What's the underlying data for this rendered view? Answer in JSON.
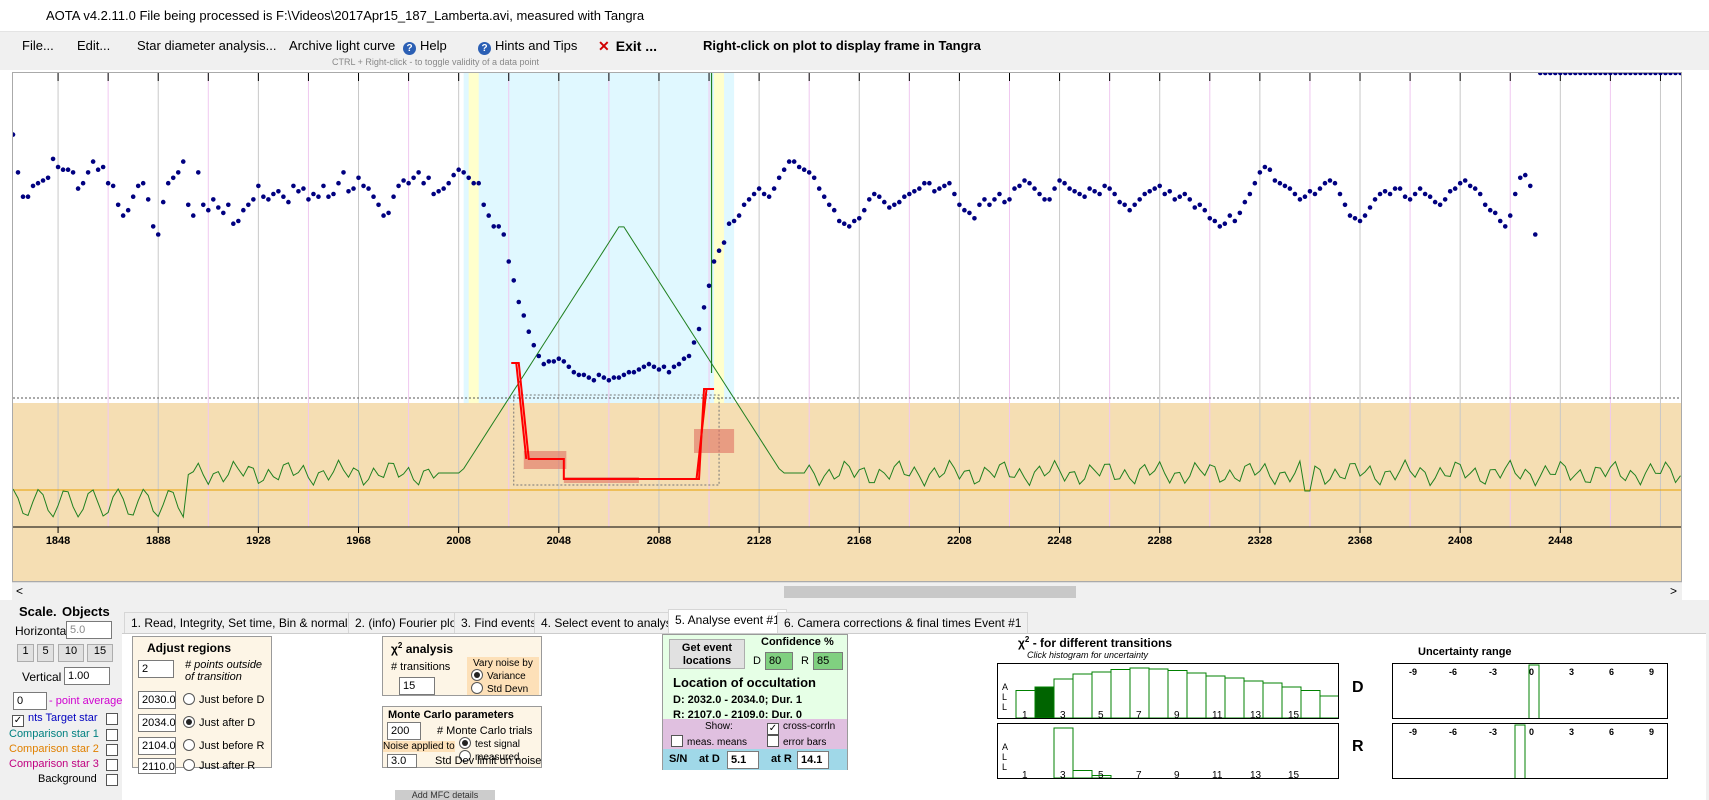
{
  "window": {
    "title": "AOTA v4.2.11.0    File being processed is F:\\Videos\\2017Apr15_187_Lamberta.avi, measured with Tangra"
  },
  "menu": {
    "file": "File...",
    "edit": "Edit...",
    "star_diameter": "Star diameter analysis...",
    "archive": "Archive light curve",
    "help": "Help",
    "hints": "Hints and Tips",
    "exit": "Exit ...",
    "rightclick_hint": "Right-click on plot to display frame in Tangra",
    "ctrl_hint": "CTRL + Right-click  -  to toggle validity of a data point"
  },
  "x_ticks": [
    "1848",
    "1888",
    "1928",
    "1968",
    "2008",
    "2048",
    "2088",
    "2128",
    "2168",
    "2208",
    "2248",
    "2288",
    "2328",
    "2368",
    "2408",
    "2448"
  ],
  "colors": {
    "points": "#000080",
    "model": "#ff0000",
    "fourier": "#208020",
    "lower_band": "#f5deb3",
    "event_shade": "#e0f8ff",
    "edge_shade": "#ffffcc",
    "baseline": "#e8a000"
  },
  "chart_data": {
    "type": "scatter",
    "x_range": [
      1830,
      2497
    ],
    "x": [
      1830,
      1832,
      1834,
      1836,
      1838,
      1840,
      1842,
      1844,
      1846,
      1848,
      1850,
      1852,
      1854,
      1856,
      1858,
      1860,
      1862,
      1864,
      1866,
      1868,
      1870,
      1872,
      1874,
      1876,
      1878,
      1880,
      1882,
      1884,
      1886,
      1888,
      1890,
      1892,
      1894,
      1896,
      1898,
      1900,
      1902,
      1904,
      1906,
      1908,
      1910,
      1912,
      1914,
      1916,
      1918,
      1920,
      1922,
      1924,
      1926,
      1928,
      1930,
      1932,
      1934,
      1936,
      1938,
      1940,
      1942,
      1944,
      1946,
      1948,
      1950,
      1952,
      1954,
      1956,
      1958,
      1960,
      1962,
      1964,
      1966,
      1968,
      1970,
      1972,
      1974,
      1976,
      1978,
      1980,
      1982,
      1984,
      1986,
      1988,
      1990,
      1992,
      1994,
      1996,
      1998,
      2000,
      2002,
      2004,
      2006,
      2008,
      2010,
      2012,
      2014,
      2016,
      2018,
      2020,
      2022,
      2024,
      2026,
      2028,
      2030,
      2032,
      2034,
      2036,
      2038,
      2040,
      2042,
      2044,
      2046,
      2048,
      2050,
      2052,
      2054,
      2056,
      2058,
      2060,
      2062,
      2064,
      2066,
      2068,
      2070,
      2072,
      2074,
      2076,
      2078,
      2080,
      2082,
      2084,
      2086,
      2088,
      2090,
      2092,
      2094,
      2096,
      2098,
      2100,
      2102,
      2104,
      2106,
      2108,
      2110,
      2112,
      2114,
      2116,
      2118,
      2120,
      2122,
      2124,
      2126,
      2128,
      2130,
      2132,
      2134,
      2136,
      2138,
      2140,
      2142,
      2144,
      2146,
      2148,
      2150,
      2152,
      2154,
      2156,
      2158,
      2160,
      2162,
      2164,
      2166,
      2168,
      2170,
      2172,
      2174,
      2176,
      2178,
      2180,
      2182,
      2184,
      2186,
      2188,
      2190,
      2192,
      2194,
      2196,
      2198,
      2200,
      2202,
      2204,
      2206,
      2208,
      2210,
      2212,
      2214,
      2216,
      2218,
      2220,
      2222,
      2224,
      2226,
      2228,
      2230,
      2232,
      2234,
      2236,
      2238,
      2240,
      2242,
      2244,
      2246,
      2248,
      2250,
      2252,
      2254,
      2256,
      2258,
      2260,
      2262,
      2264,
      2266,
      2268,
      2270,
      2272,
      2274,
      2276,
      2278,
      2280,
      2282,
      2284,
      2286,
      2288,
      2290,
      2292,
      2294,
      2296,
      2298,
      2300,
      2302,
      2304,
      2306,
      2308,
      2310,
      2312,
      2314,
      2316,
      2318,
      2320,
      2322,
      2324,
      2326,
      2328,
      2330,
      2332,
      2334,
      2336,
      2338,
      2340,
      2342,
      2344,
      2346,
      2348,
      2350,
      2352,
      2354,
      2356,
      2358,
      2360,
      2362,
      2364,
      2366,
      2368,
      2370,
      2372,
      2374,
      2376,
      2378,
      2380,
      2382,
      2384,
      2386,
      2388,
      2390,
      2392,
      2394,
      2396,
      2398,
      2400,
      2402,
      2404,
      2406,
      2408,
      2410,
      2412,
      2414,
      2416,
      2418,
      2420,
      2422,
      2424,
      2426,
      2428,
      2430,
      2432,
      2434,
      2436,
      2438,
      2440,
      2442,
      2444,
      2446,
      2448,
      2450,
      2452,
      2454,
      2456,
      2458,
      2460,
      2462,
      2464,
      2466,
      2468,
      2470,
      2472,
      2474,
      2476,
      2478,
      2480,
      2482,
      2484,
      2486,
      2488,
      2490,
      2492,
      2494,
      2496
    ],
    "y": [
      0.92,
      0.78,
      0.69,
      0.69,
      0.73,
      0.74,
      0.75,
      0.76,
      0.83,
      0.8,
      0.79,
      0.79,
      0.78,
      0.72,
      0.74,
      0.78,
      0.82,
      0.79,
      0.8,
      0.74,
      0.73,
      0.66,
      0.62,
      0.64,
      0.69,
      0.73,
      0.74,
      0.68,
      0.58,
      0.55,
      0.67,
      0.74,
      0.76,
      0.78,
      0.82,
      0.66,
      0.62,
      0.78,
      0.66,
      0.64,
      0.68,
      0.65,
      0.63,
      0.66,
      0.59,
      0.6,
      0.64,
      0.66,
      0.68,
      0.73,
      0.69,
      0.68,
      0.7,
      0.71,
      0.69,
      0.67,
      0.73,
      0.71,
      0.72,
      0.68,
      0.7,
      0.69,
      0.73,
      0.69,
      0.7,
      0.74,
      0.78,
      0.71,
      0.72,
      0.76,
      0.73,
      0.72,
      0.69,
      0.66,
      0.62,
      0.63,
      0.69,
      0.73,
      0.75,
      0.74,
      0.76,
      0.78,
      0.74,
      0.76,
      0.7,
      0.71,
      0.72,
      0.74,
      0.77,
      0.79,
      0.78,
      0.76,
      0.74,
      0.74,
      0.66,
      0.62,
      0.58,
      0.58,
      0.55,
      0.45,
      0.38,
      0.3,
      0.25,
      0.19,
      0.14,
      0.1,
      0.07,
      0.08,
      0.08,
      0.09,
      0.08,
      0.06,
      0.04,
      0.03,
      0.03,
      0.02,
      0.01,
      0.03,
      0.02,
      0.01,
      0.02,
      0.02,
      0.03,
      0.04,
      0.04,
      0.05,
      0.06,
      0.07,
      0.06,
      0.05,
      0.06,
      0.04,
      0.06,
      0.07,
      0.09,
      0.1,
      0.15,
      0.2,
      0.28,
      0.36,
      0.45,
      0.49,
      0.52,
      0.59,
      0.6,
      0.62,
      0.66,
      0.68,
      0.7,
      0.72,
      0.7,
      0.69,
      0.72,
      0.76,
      0.79,
      0.82,
      0.82,
      0.8,
      0.79,
      0.78,
      0.76,
      0.72,
      0.69,
      0.66,
      0.64,
      0.6,
      0.59,
      0.58,
      0.6,
      0.61,
      0.64,
      0.68,
      0.7,
      0.69,
      0.67,
      0.65,
      0.66,
      0.67,
      0.69,
      0.7,
      0.71,
      0.72,
      0.74,
      0.74,
      0.71,
      0.72,
      0.73,
      0.74,
      0.7,
      0.66,
      0.64,
      0.63,
      0.61,
      0.66,
      0.68,
      0.66,
      0.68,
      0.7,
      0.67,
      0.68,
      0.72,
      0.73,
      0.75,
      0.74,
      0.72,
      0.7,
      0.68,
      0.68,
      0.72,
      0.75,
      0.74,
      0.72,
      0.71,
      0.7,
      0.69,
      0.72,
      0.71,
      0.7,
      0.73,
      0.72,
      0.7,
      0.67,
      0.66,
      0.64,
      0.66,
      0.68,
      0.7,
      0.71,
      0.72,
      0.73,
      0.7,
      0.71,
      0.68,
      0.69,
      0.7,
      0.68,
      0.65,
      0.66,
      0.64,
      0.61,
      0.6,
      0.58,
      0.59,
      0.62,
      0.6,
      0.63,
      0.67,
      0.7,
      0.74,
      0.78,
      0.8,
      0.79,
      0.75,
      0.74,
      0.73,
      0.72,
      0.7,
      0.68,
      0.69,
      0.71,
      0.7,
      0.72,
      0.74,
      0.75,
      0.74,
      0.7,
      0.66,
      0.62,
      0.61,
      0.6,
      0.62,
      0.65,
      0.68,
      0.7,
      0.71,
      0.7,
      0.72,
      0.72,
      0.69,
      0.68,
      0.7,
      0.72,
      0.7,
      0.69,
      0.67,
      0.66,
      0.68,
      0.71,
      0.72,
      0.74,
      0.75,
      0.73,
      0.72,
      0.7,
      0.66,
      0.64,
      0.63,
      0.6,
      0.58,
      0.62,
      0.7,
      0.76,
      0.77,
      0.73,
      0.55
    ]
  },
  "scale": {
    "title": "Scale.",
    "horizontal_label": "Horizontal",
    "horizontal_value": "5.0",
    "vertical_label": "Vertical",
    "vertical_value": "1.00",
    "btns": [
      "1",
      "5",
      "10",
      "15"
    ]
  },
  "objects": {
    "title": "Objects",
    "point_avg_value": "0",
    "point_avg_label": "- point average",
    "target": "Target star",
    "target_prefix": "nts",
    "comp1": "Comparison star 1",
    "comp2": "Comparison star 2",
    "comp3": "Comparison star 3",
    "background": "Background"
  },
  "tabs": [
    "1.  Read, Integrity, Set time, Bin & normalise",
    "2. (info)  Fourier plot",
    "3. Find events",
    "4. Select event to analyse",
    "5. Analyse event #1",
    "6. Camera corrections & final times Event #1"
  ],
  "adjust": {
    "title": "Adjust regions",
    "points_value": "2",
    "points_label": "# points outside of transition",
    "v1": "2030.0",
    "l1": "Just before D",
    "v2": "2034.0",
    "l2": "Just after D",
    "v3": "2104.0",
    "l3": "Just before R",
    "v4": "2110.0",
    "l4": "Just after R"
  },
  "chi": {
    "title": "analysis",
    "trans_label": "# transitions",
    "trans_value": "15",
    "vary": "Vary noise by",
    "variance": "Variance",
    "stddev": "Std Devn"
  },
  "mc": {
    "title": "Monte Carlo parameters",
    "trials_value": "200",
    "trials_label": "# Monte Carlo trials",
    "noise_label": "Noise applied to",
    "test": "test signal",
    "measured": "measured",
    "std_value": "3.0",
    "std_label": "Std Dev limit on noise"
  },
  "events": {
    "get_btn": "Get event locations",
    "conf_title": "Confidence %",
    "d_label": "D",
    "d_val": "80",
    "r_label": "R",
    "r_val": "85",
    "loc_title": "Location of occultation",
    "d_line": "D: 2032.0 - 2034.0; Dur. 1",
    "r_line": "R: 2107.0 - 2109.0; Dur. 0",
    "show": "Show:",
    "crosscorr": "cross-corrln",
    "meas": "meas. means",
    "errbars": "error bars",
    "sn_label": "S/N",
    "atd_label": "at D",
    "atd_val": "5.1",
    "atr_label": "at R",
    "atr_val": "14.1"
  },
  "chi_hist": {
    "title": "- for different transitions",
    "subtitle": "Click histogram for uncertainty",
    "d_label": "D",
    "r_label": "R",
    "letters": [
      "A",
      "L",
      "L"
    ],
    "x_labels": [
      "1",
      "3",
      "5",
      "7",
      "9",
      "11",
      "13",
      "15"
    ],
    "d_values": [
      0.55,
      0.62,
      0.78,
      0.88,
      0.92,
      0.97,
      1.0,
      0.98,
      0.95,
      0.9,
      0.84,
      0.8,
      0.74,
      0.7,
      0.62,
      0.55,
      0.44
    ],
    "r_values": [
      0,
      0,
      1.0,
      0.15,
      0.05,
      0,
      0,
      0,
      0,
      0,
      0,
      0,
      0,
      0,
      0,
      0,
      0
    ]
  },
  "uncert": {
    "title": "Uncertainty range",
    "labels": [
      "-9",
      "-6",
      "-3",
      "0",
      "3",
      "6",
      "9"
    ]
  },
  "taskbar_fragment": "Add MFC details"
}
